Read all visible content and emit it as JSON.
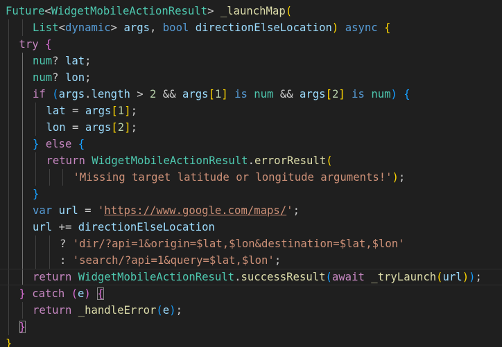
{
  "editor": {
    "lines": [
      {
        "indent": 0,
        "tokens": [
          [
            "type",
            "Future"
          ],
          [
            "op",
            "<"
          ],
          [
            "type",
            "WidgetMobileActionResult"
          ],
          [
            "op",
            "> "
          ],
          [
            "fn",
            "_launchMap"
          ],
          [
            "b1",
            "("
          ]
        ]
      },
      {
        "indent": 2,
        "tokens": [
          [
            "type",
            "List"
          ],
          [
            "op",
            "<"
          ],
          [
            "kw",
            "dynamic"
          ],
          [
            "op",
            "> "
          ],
          [
            "var",
            "args"
          ],
          [
            "op",
            ", "
          ],
          [
            "kw",
            "bool"
          ],
          [
            "op",
            " "
          ],
          [
            "var",
            "directionElseLocation"
          ],
          [
            "b1",
            ")"
          ],
          [
            "op",
            " "
          ],
          [
            "kw",
            "async"
          ],
          [
            "op",
            " "
          ],
          [
            "b1",
            "{"
          ]
        ]
      },
      {
        "indent": 1,
        "tokens": [
          [
            "ctl",
            "try"
          ],
          [
            "op",
            " "
          ],
          [
            "b2",
            "{"
          ]
        ]
      },
      {
        "indent": 2,
        "tokens": [
          [
            "type",
            "num"
          ],
          [
            "op",
            "? "
          ],
          [
            "var",
            "lat"
          ],
          [
            "op",
            ";"
          ]
        ]
      },
      {
        "indent": 2,
        "tokens": [
          [
            "type",
            "num"
          ],
          [
            "op",
            "? "
          ],
          [
            "var",
            "lon"
          ],
          [
            "op",
            ";"
          ]
        ]
      },
      {
        "indent": 2,
        "tokens": [
          [
            "ctl",
            "if"
          ],
          [
            "op",
            " "
          ],
          [
            "b3",
            "("
          ],
          [
            "var",
            "args"
          ],
          [
            "op",
            "."
          ],
          [
            "var",
            "length"
          ],
          [
            "op",
            " > "
          ],
          [
            "num",
            "2"
          ],
          [
            "op",
            " && "
          ],
          [
            "var",
            "args"
          ],
          [
            "b1",
            "["
          ],
          [
            "num",
            "1"
          ],
          [
            "b1",
            "]"
          ],
          [
            "op",
            " "
          ],
          [
            "kw",
            "is"
          ],
          [
            "op",
            " "
          ],
          [
            "type",
            "num"
          ],
          [
            "op",
            " && "
          ],
          [
            "var",
            "args"
          ],
          [
            "b1",
            "["
          ],
          [
            "num",
            "2"
          ],
          [
            "b1",
            "]"
          ],
          [
            "op",
            " "
          ],
          [
            "kw",
            "is"
          ],
          [
            "op",
            " "
          ],
          [
            "type",
            "num"
          ],
          [
            "b3",
            ")"
          ],
          [
            "op",
            " "
          ],
          [
            "b3",
            "{"
          ]
        ]
      },
      {
        "indent": 3,
        "tokens": [
          [
            "var",
            "lat"
          ],
          [
            "op",
            " = "
          ],
          [
            "var",
            "args"
          ],
          [
            "b1",
            "["
          ],
          [
            "num",
            "1"
          ],
          [
            "b1",
            "]"
          ],
          [
            "op",
            ";"
          ]
        ]
      },
      {
        "indent": 3,
        "tokens": [
          [
            "var",
            "lon"
          ],
          [
            "op",
            " = "
          ],
          [
            "var",
            "args"
          ],
          [
            "b1",
            "["
          ],
          [
            "num",
            "2"
          ],
          [
            "b1",
            "]"
          ],
          [
            "op",
            ";"
          ]
        ]
      },
      {
        "indent": 2,
        "tokens": [
          [
            "b3",
            "}"
          ],
          [
            "op",
            " "
          ],
          [
            "ctl",
            "else"
          ],
          [
            "op",
            " "
          ],
          [
            "b3",
            "{"
          ]
        ]
      },
      {
        "indent": 3,
        "tokens": [
          [
            "ctl",
            "return"
          ],
          [
            "op",
            " "
          ],
          [
            "type",
            "WidgetMobileActionResult"
          ],
          [
            "op",
            "."
          ],
          [
            "fn",
            "errorResult"
          ],
          [
            "b1",
            "("
          ]
        ]
      },
      {
        "indent": 5,
        "tokens": [
          [
            "str",
            "'Missing target latitude or longitude arguments!'"
          ],
          [
            "b1",
            ")"
          ],
          [
            "op",
            ";"
          ]
        ]
      },
      {
        "indent": 2,
        "tokens": [
          [
            "b3",
            "}"
          ]
        ]
      },
      {
        "indent": 2,
        "tokens": [
          [
            "kw",
            "var"
          ],
          [
            "op",
            " "
          ],
          [
            "var",
            "url"
          ],
          [
            "op",
            " = "
          ],
          [
            "str",
            "'"
          ],
          [
            "url",
            "https://www.google.com/maps/"
          ],
          [
            "str",
            "'"
          ],
          [
            "op",
            ";"
          ]
        ]
      },
      {
        "indent": 2,
        "tokens": [
          [
            "var",
            "url"
          ],
          [
            "op",
            " += "
          ],
          [
            "var",
            "directionElseLocation"
          ]
        ]
      },
      {
        "indent": 4,
        "tokens": [
          [
            "op",
            "? "
          ],
          [
            "str",
            "'dir/?api=1&origin=$lat,$lon&destination=$lat,$lon'"
          ]
        ]
      },
      {
        "indent": 4,
        "tokens": [
          [
            "op",
            ": "
          ],
          [
            "str",
            "'search/?api=1&query=$lat,$lon'"
          ],
          [
            "op",
            ";"
          ]
        ]
      },
      {
        "indent": 2,
        "tokens": [
          [
            "ctl",
            "return"
          ],
          [
            "op",
            " "
          ],
          [
            "type",
            "WidgetMobileActionResult"
          ],
          [
            "op",
            "."
          ],
          [
            "fn",
            "successResult"
          ],
          [
            "b3",
            "("
          ],
          [
            "ctl",
            "await"
          ],
          [
            "op",
            " "
          ],
          [
            "fn",
            "_tryLaunch"
          ],
          [
            "b1",
            "("
          ],
          [
            "var",
            "url"
          ],
          [
            "b1",
            ")"
          ],
          [
            "b3",
            ")"
          ],
          [
            "op",
            ";"
          ]
        ]
      },
      {
        "indent": 1,
        "tokens": [
          [
            "b2",
            "}"
          ],
          [
            "op",
            " "
          ],
          [
            "ctl",
            "catch"
          ],
          [
            "op",
            " "
          ],
          [
            "b2",
            "("
          ],
          [
            "var",
            "e"
          ],
          [
            "b2",
            ")"
          ],
          [
            "op",
            " "
          ],
          [
            "b2m",
            "{"
          ]
        ]
      },
      {
        "indent": 2,
        "tokens": [
          [
            "ctl",
            "return"
          ],
          [
            "op",
            " "
          ],
          [
            "fn",
            "_handleError"
          ],
          [
            "b3",
            "("
          ],
          [
            "var",
            "e"
          ],
          [
            "b3",
            ")"
          ],
          [
            "op",
            ";"
          ]
        ]
      },
      {
        "indent": 1,
        "tokens": [
          [
            "b2m",
            "}"
          ]
        ]
      },
      {
        "indent": 0,
        "tokens": [
          [
            "b1",
            "}"
          ]
        ]
      }
    ]
  }
}
